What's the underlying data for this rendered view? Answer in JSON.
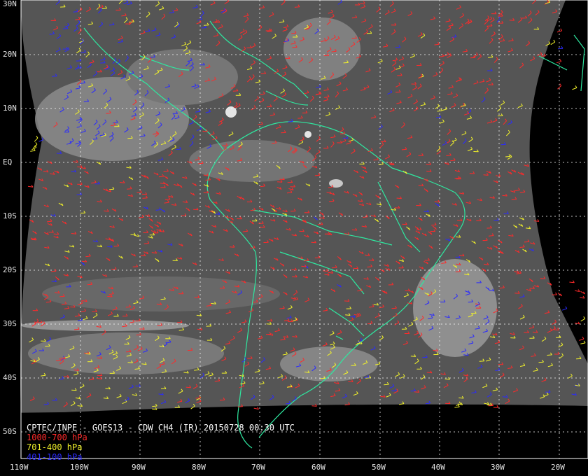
{
  "caption": {
    "title": "CPTEC/INPE - GOES13 - CDW CH4 (IR) 20150728 00:30 UTC"
  },
  "legend": [
    {
      "label": "1000-700 hPa",
      "color": "#ff2a2a"
    },
    {
      "label": "701-400 hPa",
      "color": "#f2f22a"
    },
    {
      "label": "401-100 hPa",
      "color": "#2a2aff"
    }
  ],
  "axes": {
    "lat_labels": [
      "30N",
      "20N",
      "10N",
      "EQ",
      "10S",
      "20S",
      "30S",
      "40S",
      "50S"
    ],
    "lon_labels": [
      "110W",
      "100W",
      "90W",
      "80W",
      "70W",
      "60W",
      "50W",
      "40W",
      "30W",
      "20W"
    ]
  },
  "colors": {
    "background": "#000000",
    "grid": "#ffffff",
    "coastline": "#2ee8a0",
    "low_level": "#ff2a2a",
    "mid_level": "#f2f22a",
    "high_level": "#2a2aff"
  }
}
